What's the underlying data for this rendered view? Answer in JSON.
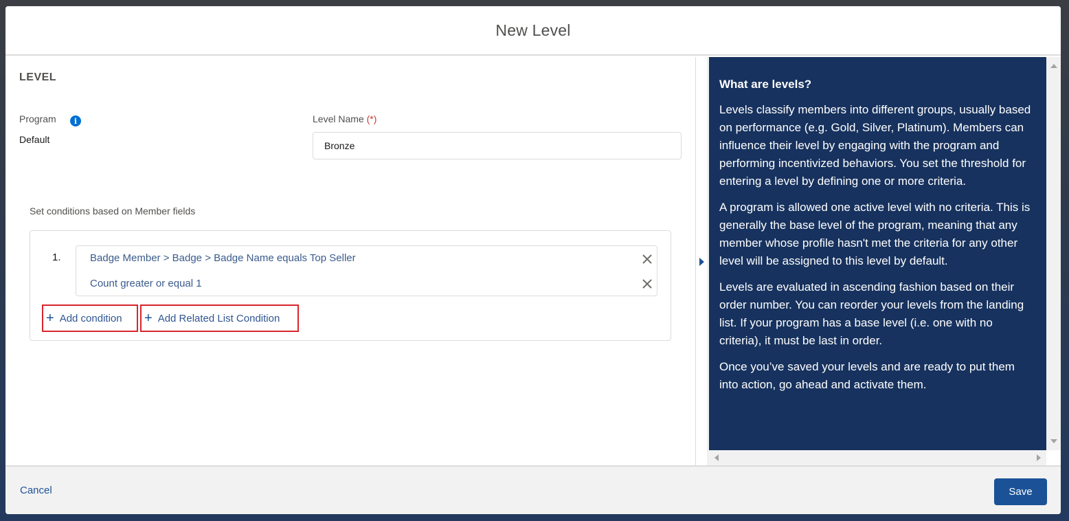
{
  "modal": {
    "title": "New Level"
  },
  "form": {
    "section_title": "LEVEL",
    "program": {
      "label": "Program",
      "value": "Default"
    },
    "level_name": {
      "label": "Level Name",
      "required_marker": "(*)",
      "value": "Bronze"
    },
    "conditions_hint": "Set conditions based on Member fields",
    "conditions": [
      {
        "number": "1.",
        "lines": [
          "Badge Member > Badge > Badge Name equals Top Seller",
          "Count greater or equal 1"
        ]
      }
    ],
    "add_condition_label": "Add condition",
    "add_related_label": "Add Related List Condition"
  },
  "help": {
    "title": "What are levels?",
    "paragraphs": [
      "Levels classify members into different groups, usually based on performance (e.g. Gold, Silver, Platinum). Members can influence their level by engaging with the program and performing incentivized behaviors. You set the threshold for entering a level by defining one or more criteria.",
      "A program is allowed one active level with no criteria. This is generally the base level of the program, meaning that any member whose profile hasn't met the criteria for any other level will be assigned to this level by default.",
      "Levels are evaluated in ascending fashion based on their order number. You can reorder your levels from the landing list. If your program has a base level (i.e. one with no criteria), it must be last in order.",
      "Once you’ve saved your levels and are ready to put them into action, go ahead and activate them."
    ]
  },
  "footer": {
    "cancel_label": "Cancel",
    "save_label": "Save"
  },
  "colors": {
    "help_panel_bg": "#17325e",
    "primary_button": "#1b5297",
    "highlight_border": "#d9242c",
    "info_icon": "#0070d2"
  },
  "icons": {
    "info": "info-icon",
    "remove": "close-icon",
    "add": "plus-icon",
    "collapse": "caret-right-icon"
  }
}
